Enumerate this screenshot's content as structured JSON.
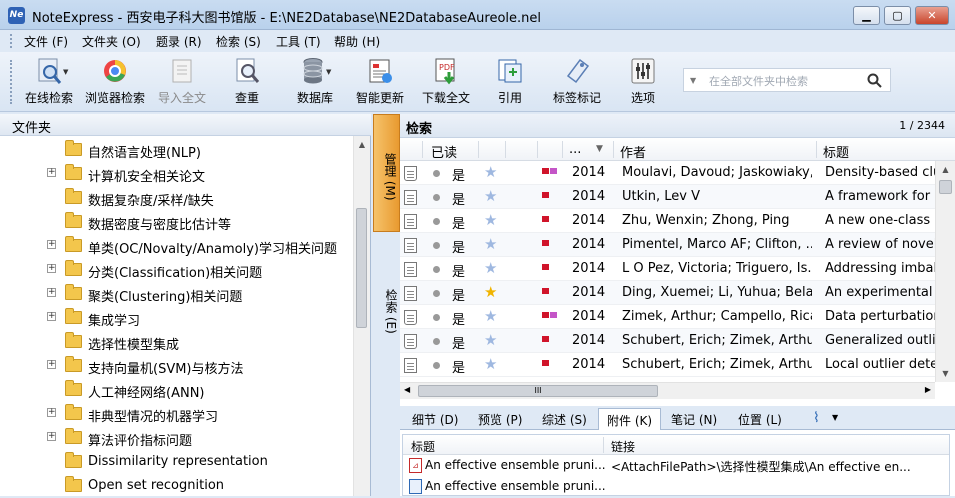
{
  "window": {
    "title": "NoteExpress - 西安电子科大图书馆版 - E:\\NE2Database\\NE2DatabaseAureole.nel",
    "app_icon": "Ne"
  },
  "menu": [
    "文件 (F)",
    "文件夹 (O)",
    "题录 (R)",
    "检索 (S)",
    "工具 (T)",
    "帮助 (H)"
  ],
  "toolbar": [
    {
      "label": "在线检索",
      "icon": "online-search-icon",
      "disabled": false
    },
    {
      "label": "浏览器检索",
      "icon": "browser-search-icon",
      "disabled": false
    },
    {
      "label": "导入全文",
      "icon": "import-fulltext-icon",
      "disabled": true
    },
    {
      "label": "查重",
      "icon": "find-duplicates-icon",
      "disabled": false
    },
    {
      "label": "数据库",
      "icon": "database-icon",
      "disabled": false
    },
    {
      "label": "智能更新",
      "icon": "smart-update-icon",
      "disabled": false
    },
    {
      "label": "下载全文",
      "icon": "download-fulltext-icon",
      "disabled": false
    },
    {
      "label": "引用",
      "icon": "cite-icon",
      "disabled": false
    },
    {
      "label": "标签标记",
      "icon": "tag-icon",
      "disabled": false
    },
    {
      "label": "选项",
      "icon": "options-icon",
      "disabled": false
    }
  ],
  "search": {
    "placeholder": "在全部文件夹中检索"
  },
  "folder_pane": {
    "title": "文件夹",
    "items": [
      {
        "label": "自然语言处理(NLP)",
        "expandable": false
      },
      {
        "label": "计算机安全相关论文",
        "expandable": true
      },
      {
        "label": "数据复杂度/采样/缺失",
        "expandable": false
      },
      {
        "label": "数据密度与密度比估计等",
        "expandable": false
      },
      {
        "label": "单类(OC/Novalty/Anamoly)学习相关问题",
        "expandable": true
      },
      {
        "label": "分类(Classification)相关问题",
        "expandable": true
      },
      {
        "label": "聚类(Clustering)相关问题",
        "expandable": true
      },
      {
        "label": "集成学习",
        "expandable": true
      },
      {
        "label": "选择性模型集成",
        "expandable": false
      },
      {
        "label": "支持向量机(SVM)与核方法",
        "expandable": true
      },
      {
        "label": "人工神经网络(ANN)",
        "expandable": false
      },
      {
        "label": "非典型情况的机器学习",
        "expandable": true
      },
      {
        "label": "算法评价指标问题",
        "expandable": true
      },
      {
        "label": "Dissimilarity representation",
        "expandable": false
      },
      {
        "label": "Open set recognition",
        "expandable": false
      }
    ]
  },
  "side_tabs": {
    "manage": "管理 (M)",
    "search": "检索 (E)"
  },
  "results": {
    "title": "检索",
    "count": "1 / 2344",
    "columns": {
      "read": "已读",
      "year": "...",
      "author": "作者",
      "title": "标题"
    },
    "rows": [
      {
        "read": "是",
        "fav": false,
        "labels": 2,
        "year": "2014",
        "author": "Moulavi, Davoud; Jaskowiaky,...",
        "title": "Density-based clu",
        "attach": true
      },
      {
        "read": "是",
        "fav": false,
        "labels": 1,
        "year": "2014",
        "author": "Utkin, Lev V",
        "title": "A framework for i",
        "attach": false
      },
      {
        "read": "是",
        "fav": false,
        "labels": 1,
        "year": "2014",
        "author": "Zhu, Wenxin; Zhong, Ping",
        "title": "A new one-class S",
        "attach": false
      },
      {
        "read": "是",
        "fav": false,
        "labels": 1,
        "year": "2014",
        "author": "Pimentel, Marco AF; Clifton, ...",
        "title": "A review of novelt",
        "attach": false
      },
      {
        "read": "是",
        "fav": false,
        "labels": 1,
        "year": "2014",
        "author": "L O Pez, Victoria; Triguero, Is...",
        "title": "Addressing imbala",
        "attach": false
      },
      {
        "read": "是",
        "fav": true,
        "labels": 1,
        "year": "2014",
        "author": "Ding, Xuemei; Li, Yuhua; Belat...",
        "title": "An experimental e",
        "attach": false
      },
      {
        "read": "是",
        "fav": false,
        "labels": 2,
        "year": "2014",
        "author": "Zimek, Arthur; Campello, Rica...",
        "title": "Data perturbation",
        "attach": true
      },
      {
        "read": "是",
        "fav": false,
        "labels": 1,
        "year": "2014",
        "author": "Schubert, Erich; Zimek, Arthu...",
        "title": "Generalized outlie",
        "attach": true
      },
      {
        "read": "是",
        "fav": false,
        "labels": 1,
        "year": "2014",
        "author": "Schubert, Erich; Zimek, Arthu...",
        "title": "Local outlier detec",
        "attach": false
      }
    ],
    "hscroll_label": "III"
  },
  "bottom_tabs": [
    "细节 (D)",
    "预览 (P)",
    "综述 (S)",
    "附件 (K)",
    "笔记 (N)",
    "位置 (L)"
  ],
  "bottom_active": 3,
  "attachments": {
    "columns": {
      "title": "标题",
      "link": "链接"
    },
    "rows": [
      {
        "title": "An effective ensemble pruni...",
        "link": "<AttachFilePath>\\选择性模型集成\\An effective en...",
        "type": "pdf"
      },
      {
        "title": "An effective ensemble pruni...",
        "link": "",
        "type": "file"
      }
    ]
  }
}
